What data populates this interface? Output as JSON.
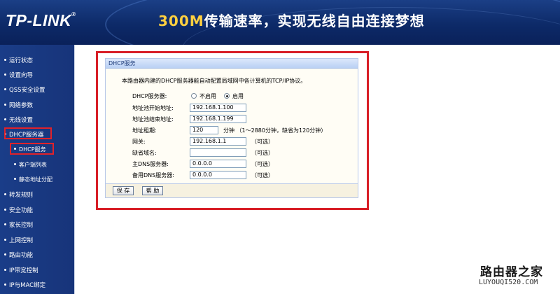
{
  "header": {
    "logo": "TP-LINK",
    "logo_reg": "®",
    "slogan_highlight": "300M",
    "slogan_rest": "传输速率，实现无线自由连接梦想"
  },
  "sidebar": {
    "items": [
      {
        "label": "运行状态"
      },
      {
        "label": "设置向导"
      },
      {
        "label": "QSS安全设置"
      },
      {
        "label": "网络参数"
      },
      {
        "label": "无线设置"
      },
      {
        "label": "DHCP服务器"
      },
      {
        "label": "DHCP服务"
      },
      {
        "label": "客户端列表"
      },
      {
        "label": "静态地址分配"
      },
      {
        "label": "转发规则"
      },
      {
        "label": "安全功能"
      },
      {
        "label": "家长控制"
      },
      {
        "label": "上网控制"
      },
      {
        "label": "路由功能"
      },
      {
        "label": "IP带宽控制"
      },
      {
        "label": "IP与MAC绑定"
      }
    ]
  },
  "panel": {
    "title": "DHCP服务",
    "intro": "本路由器内建的DHCP服务器能自动配置局域网中各计算机的TCP/IP协议。",
    "dhcp_label": "DHCP服务器:",
    "disable_label": "不启用",
    "enable_label": "启用",
    "selected": "启用",
    "start_label": "地址池开始地址:",
    "start_value": "192.168.1.100",
    "end_label": "地址池结束地址:",
    "end_value": "192.168.1.199",
    "lease_label": "地址租期:",
    "lease_value": "120",
    "lease_note": "分钟 （1～2880分钟，缺省为120分钟）",
    "gateway_label": "网关:",
    "gateway_value": "192.168.1.1",
    "domain_label": "缺省域名:",
    "domain_value": "",
    "dns1_label": "主DNS服务器:",
    "dns1_value": "0.0.0.0",
    "dns2_label": "备用DNS服务器:",
    "dns2_value": "0.0.0.0",
    "optional": "（可选）",
    "save_label": "保 存",
    "help_label": "帮 助"
  },
  "watermark": {
    "line1": "路由器之家",
    "line2": "LUYOUQI520.COM"
  },
  "colors": {
    "header": "#0d2a68",
    "sidebar": "#17347a",
    "highlight_frame": "#d81f27",
    "accent_text": "#ffd040"
  }
}
